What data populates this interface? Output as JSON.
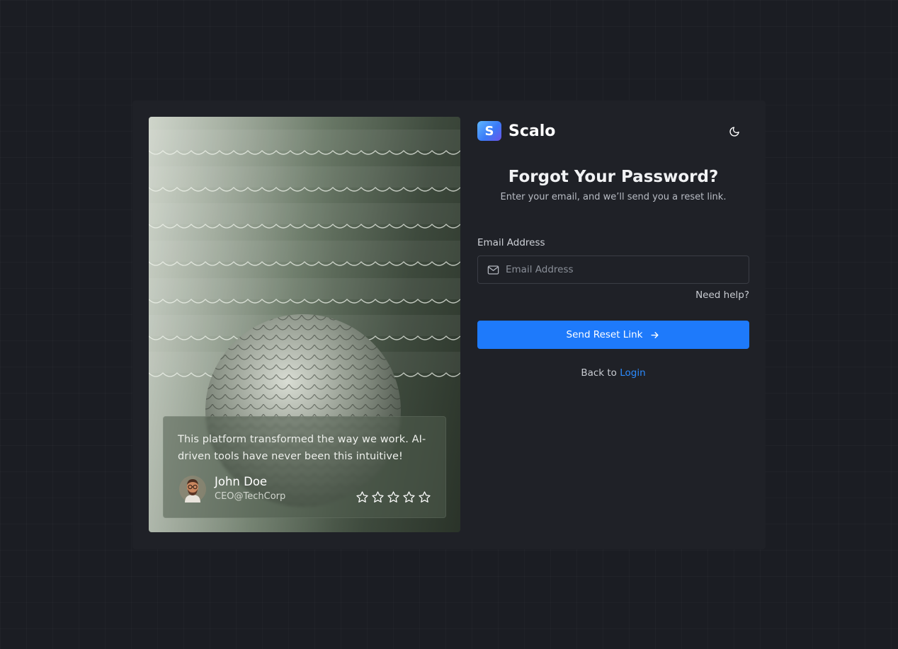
{
  "brand": {
    "name": "Scalo",
    "logo_letter": "S"
  },
  "header": {
    "theme_toggle_icon": "moon-icon"
  },
  "form": {
    "title": "Forgot Your Password?",
    "subtitle": "Enter your email, and we’ll send you a reset link.",
    "email_label": "Email Address",
    "email_placeholder": "Email Address",
    "email_value": "",
    "email_icon": "mail-icon",
    "help_link": "Need help?",
    "submit_label": "Send Reset Link",
    "submit_icon": "arrow-right-icon",
    "back_prefix": "Back to",
    "back_link": "Login"
  },
  "testimonial": {
    "quote": "This platform transformed the way we work. AI-driven tools have never been this intuitive!",
    "author_name": "John Doe",
    "author_role": "CEO@TechCorp",
    "rating": 0,
    "rating_max": 5
  },
  "colors": {
    "page_bg": "#1b1d23",
    "card_bg": "#1f2127",
    "accent": "#1e7afb",
    "link": "#2b8bff"
  }
}
